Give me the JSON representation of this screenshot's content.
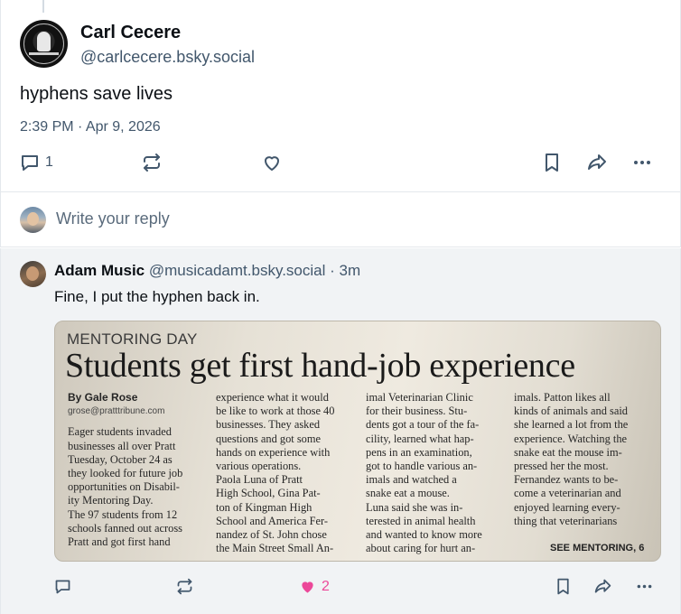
{
  "main_post": {
    "display_name": "Carl Cecere",
    "handle": "@carlcecere.bsky.social",
    "text": "hyphens save lives",
    "timestamp": "2:39 PM · Apr 9, 2026",
    "reply_count": "1",
    "icons": [
      "reply-icon",
      "repost-icon",
      "like-icon",
      "bookmark-icon",
      "share-icon",
      "more-icon"
    ]
  },
  "composer": {
    "placeholder": "Write your reply"
  },
  "reply_post": {
    "display_name": "Adam Music",
    "handle": "@musicadamt.bsky.social",
    "age": "· 3m",
    "text": "Fine, I put the hyphen back in.",
    "like_count": "2",
    "clipping": {
      "section": "MENTORING DAY",
      "headline": "Students get first hand-job experience",
      "byline": "By Gale Rose",
      "email": "grose@pratttribune.com",
      "columns": [
        [
          "Eager students invaded",
          "businesses all over Pratt",
          "Tuesday, October 24 as",
          "they looked for future job",
          "opportunities on Disabil-",
          "ity Mentoring Day.",
          "The 97 students from 12",
          "schools fanned out across",
          "Pratt and got first hand"
        ],
        [
          "experience what it would",
          "be like to work at those 40",
          "businesses. They asked",
          "questions and got some",
          "hands on experience with",
          "various operations.",
          "Paola Luna of Pratt",
          "High School, Gina Pat-",
          "ton of Kingman High",
          "School and America Fer-",
          "nandez of St. John chose",
          "the Main Street Small An-"
        ],
        [
          "imal Veterinarian Clinic",
          "for their business. Stu-",
          "dents got a tour of the fa-",
          "cility, learned what hap-",
          "pens in an examination,",
          "got to handle various an-",
          "imals and watched a",
          "snake eat a mouse.",
          "Luna said she was in-",
          "terested in animal health",
          "and wanted to know more",
          "about caring for hurt an-"
        ],
        [
          "imals. Patton likes all",
          "kinds of animals and said",
          "she learned a lot from the",
          "experience. Watching the",
          "snake eat the mouse im-",
          "pressed her the most.",
          "Fernandez wants to be-",
          "come a veterinarian and",
          "enjoyed learning every-",
          "thing that veterinarians"
        ]
      ],
      "continuation": "SEE MENTORING, 6"
    }
  },
  "colors": {
    "text_primary": "#0b0f14",
    "text_secondary": "#42576c",
    "like_pink": "#ec4899",
    "reply_background": "#f1f3f5",
    "border": "#e4e8ec"
  }
}
